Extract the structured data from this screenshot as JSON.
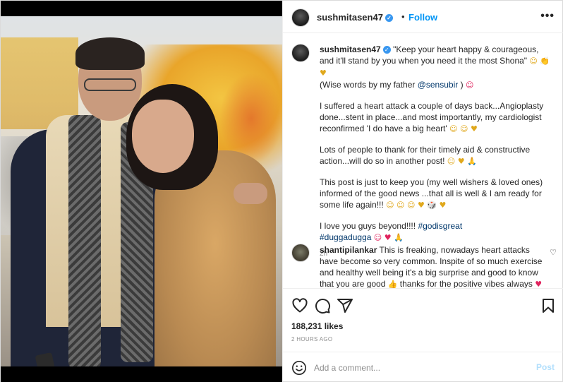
{
  "post": {
    "username": "sushmitasen47",
    "follow_label": "Follow",
    "dot": "•",
    "more": "•••"
  },
  "caption": {
    "username": "sushmitasen47",
    "line1": "\"Keep your heart happy & courageous, and it'll stand by you when you need it the most Shona\"",
    "line1_emoji": "☺ 👏 ♥",
    "line2_pre": "(Wise words by my father ",
    "line2_tag": "@sensubir",
    "line2_post": " )",
    "line2_emoji": "☺",
    "para2": "I suffered a heart attack a couple of days back...Angioplasty done...stent in place...and most importantly, my cardiologist reconfirmed 'I do have a big heart'",
    "para2_emoji": "☺ ☺ ♥",
    "para3": "Lots of people to thank for their timely aid & constructive action...will do so in another post!",
    "para3_emoji": "☺ ♥ 🙏",
    "para4": "This post is just to keep you (my well wishers & loved ones) informed of the good news ...that all is well & I am ready for some life again!!!",
    "para4_emoji": "☺ ☺ ☺ ♥ 🎲 ♥",
    "para5": "I love you guys beyond!!!!",
    "para5_tag1": "#godisgreat",
    "para5_tag2": "#duggadugga",
    "para5_emoji": "☺ ♥ 🙏",
    "time": "2h"
  },
  "top_comment": {
    "username": "shantipilankar",
    "text": "This is freaking, nowadays heart attacks have become so very common. Inspite of so much exercise and healthy well being it's a big surprise and good to know that you are good",
    "text_emoji": "👍",
    "text_end": "thanks for the positive vibes always",
    "end_emoji": "♥",
    "like_icon": "♡"
  },
  "actions": {
    "likes": "188,231 likes",
    "posted": "2 HOURS AGO"
  },
  "add_comment": {
    "placeholder": "Add a comment...",
    "post_label": "Post"
  },
  "icons": [
    "heart-icon",
    "comment-icon",
    "share-icon",
    "bookmark-icon",
    "emoji-icon",
    "verified-icon",
    "more-icon"
  ],
  "colors": {
    "accent": "#0095f6",
    "post_disabled": "#b2dffc",
    "tag": "#00376b",
    "heart": "#ed4956"
  }
}
